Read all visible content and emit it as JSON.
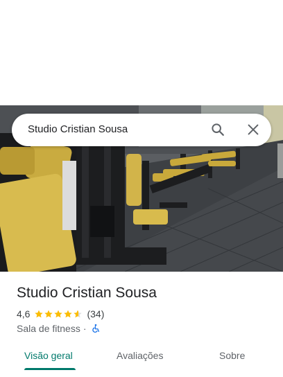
{
  "search": {
    "query": "Studio Cristian Sousa"
  },
  "place": {
    "name": "Studio Cristian Sousa",
    "rating": "4,6",
    "rating_value": 4.6,
    "stars_max": 5,
    "review_count": "(34)",
    "category": "Sala de fitness",
    "separator": "·"
  },
  "tabs": [
    {
      "label": "Visão geral",
      "active": true
    },
    {
      "label": "Avaliações",
      "active": false
    },
    {
      "label": "Sobre",
      "active": false
    }
  ],
  "colors": {
    "accent": "#00796b",
    "star": "#fbbc04",
    "accessibility": "#1a73e8"
  },
  "icons": {
    "search": "search-icon",
    "close": "close-icon",
    "accessibility": "wheelchair-icon"
  }
}
